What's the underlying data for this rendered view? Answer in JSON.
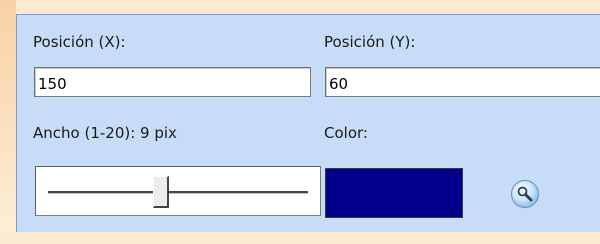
{
  "position_x": {
    "label": "Posición (X):",
    "value": "150"
  },
  "position_y": {
    "label": "Posición (Y):",
    "value": "60"
  },
  "width": {
    "label": "Ancho (1-20): 9 pix",
    "value": 9,
    "min": 1,
    "max": 20
  },
  "color": {
    "label": "Color:",
    "value": "#00008b"
  },
  "color_picker": {
    "icon": "magnifier-icon"
  },
  "colors": {
    "panel": "#c7dcf7",
    "background": "#fde9cf"
  }
}
